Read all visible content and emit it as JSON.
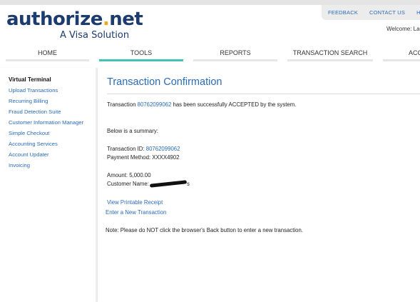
{
  "brand": {
    "logo_left": "authorize",
    "logo_dot": ".",
    "logo_right": "net",
    "tagline": "A Visa Solution",
    "navy": "#1c3b6e",
    "accent": "#f3a41b"
  },
  "top_links": [
    "FEEDBACK",
    "CONTACT US",
    "H"
  ],
  "welcome": "Welcome: La",
  "nav": {
    "tabs": [
      "HOME",
      "TOOLS",
      "REPORTS",
      "TRANSACTION SEARCH",
      "ACC"
    ],
    "active": "TOOLS",
    "active_color": "#3fc5b6"
  },
  "sidebar": {
    "heading": "Virtual Terminal",
    "items": [
      "Upload Transactions",
      "Recurring Billing",
      "Fraud Detection Suite",
      "Customer Information Manager",
      "Simple Checkout",
      "Accounting Services",
      "Account Updater",
      "Invoicing"
    ]
  },
  "main": {
    "title": "Transaction Confirmation",
    "confirm_prefix": "Transaction ",
    "transaction_id": "80762099062",
    "confirm_suffix": " has been successfully ACCEPTED by the system.",
    "summary_intro": "Below is a summary:",
    "txid_label": "Transaction ID: ",
    "payment_method": "Payment Method: XXXX4902",
    "amount": "Amount: 5,000.00",
    "customer_label": "Customer Name:",
    "customer_tail": "s",
    "receipt_link": "View Printable Receipt",
    "new_transaction_link": "Enter a New Transaction",
    "note": "Note: Please do NOT click the browser's Back button to enter a new transaction."
  }
}
